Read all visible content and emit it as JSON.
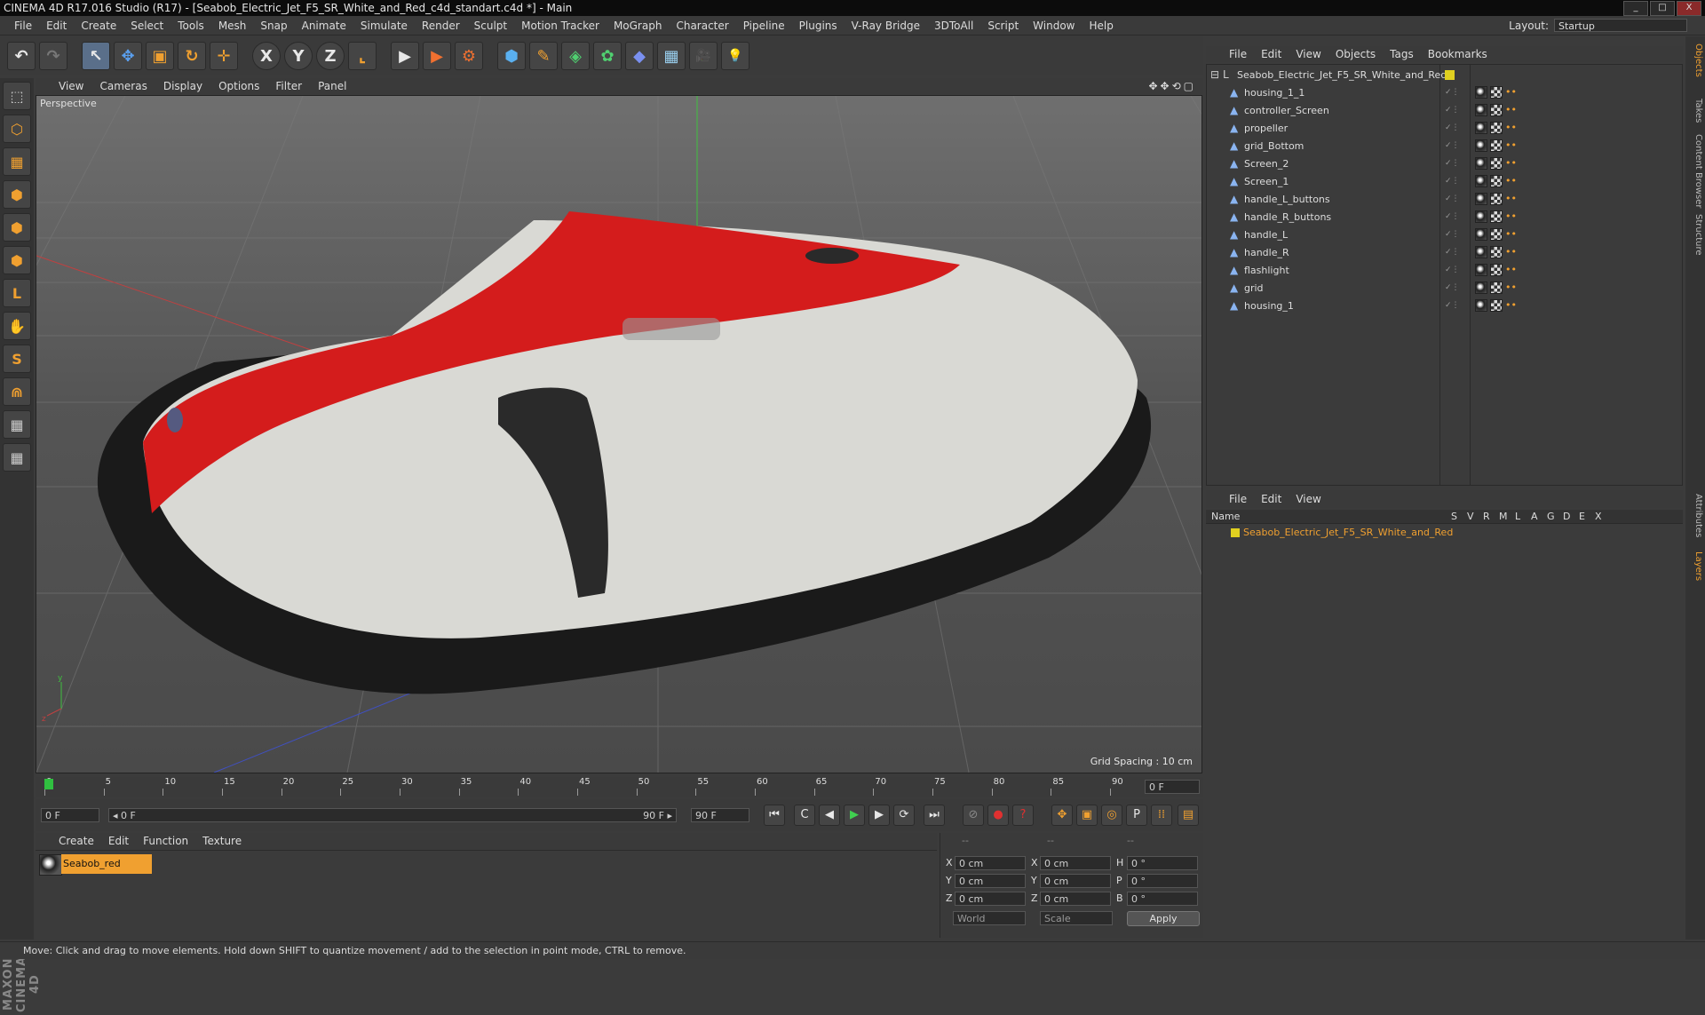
{
  "window": {
    "title": "CINEMA 4D R17.016 Studio (R17) - [Seabob_Electric_Jet_F5_SR_White_and_Red_c4d_standart.c4d *] - Main",
    "buttons": [
      "_",
      "□",
      "X"
    ]
  },
  "menubar": {
    "items": [
      "File",
      "Edit",
      "Create",
      "Select",
      "Tools",
      "Mesh",
      "Snap",
      "Animate",
      "Simulate",
      "Render",
      "Sculpt",
      "Motion Tracker",
      "MoGraph",
      "Character",
      "Pipeline",
      "Plugins",
      "V-Ray Bridge",
      "3DToAll",
      "Script",
      "Window",
      "Help"
    ],
    "layout_label": "Layout:",
    "layout_value": "Startup"
  },
  "toolbar": {
    "glyphs": {
      "undo": "↶",
      "redo": "↷",
      "live_select": "↖",
      "move": "✥",
      "scale": "▣",
      "rotate": "↻",
      "transform": "✛",
      "x_axis": "X",
      "y_axis": "Y",
      "z_axis": "Z",
      "coord": "⌞",
      "render_view": "▶",
      "render_pv": "▶",
      "render_settings": "⚙",
      "cube": "⬢",
      "pen": "✎",
      "subdiv": "◈",
      "cloner": "✿",
      "deformer": "◆",
      "floor": "▦",
      "camera": "🎥",
      "light": "💡"
    }
  },
  "lefttools": [
    "⬚",
    "⬡",
    "▦",
    "⬢",
    "⬢",
    "⬢",
    "L",
    "✋",
    "S",
    "⋒",
    "▦",
    "▦"
  ],
  "maxon_logo": "MAXON CINEMA 4D",
  "viewport": {
    "menu": [
      "View",
      "Cameras",
      "Display",
      "Options",
      "Filter",
      "Panel"
    ],
    "nav_icons": "✥✥⟲▢",
    "label": "Perspective",
    "grid_spacing": "Grid Spacing : 10 cm",
    "axis_y": "y",
    "axis_z": "z"
  },
  "timeline": {
    "ticks": [
      "0",
      "5",
      "10",
      "15",
      "20",
      "25",
      "30",
      "35",
      "40",
      "45",
      "50",
      "55",
      "60",
      "65",
      "70",
      "75",
      "80",
      "85",
      "90"
    ],
    "current_frame": "0 F",
    "current_frame_fraction": 0.0
  },
  "transport": {
    "start_field": "0 F",
    "range_start": "◂ 0 F",
    "range_end": "90 F ▸",
    "end_field": "90 F",
    "buttons": [
      "⏮",
      "C",
      "◀",
      "▶",
      "▶",
      "⟳",
      "⏭",
      "⊘",
      "●",
      "?",
      "✥",
      "▣",
      "◎",
      "P",
      "⁞⁞",
      "▤"
    ]
  },
  "material_manager": {
    "menu": [
      "Create",
      "Edit",
      "Function",
      "Texture"
    ],
    "materials": [
      {
        "name": "Seabob_red"
      }
    ]
  },
  "coords": {
    "headers": [
      "--",
      "--",
      "--"
    ],
    "rows": [
      {
        "l1": "X",
        "v1": "0 cm",
        "l2": "X",
        "v2": "0 cm",
        "l3": "H",
        "v3": "0 °"
      },
      {
        "l1": "Y",
        "v1": "0 cm",
        "l2": "Y",
        "v2": "0 cm",
        "l3": "P",
        "v3": "0 °"
      },
      {
        "l1": "Z",
        "v1": "0 cm",
        "l2": "Z",
        "v2": "0 cm",
        "l3": "B",
        "v3": "0 °"
      }
    ],
    "mode1": "World",
    "mode2": "Scale",
    "apply": "Apply"
  },
  "status": "Move: Click and drag to move elements. Hold down SHIFT to quantize movement / add to the selection in point mode, CTRL to remove.",
  "objects": {
    "menu": [
      "File",
      "Edit",
      "View",
      "Objects",
      "Tags",
      "Bookmarks"
    ],
    "root": "Seabob_Electric_Jet_F5_SR_White_and_Red",
    "children": [
      "housing_1_1",
      "controller_Screen",
      "propeller",
      "grid_Bottom",
      "Screen_2",
      "Screen_1",
      "handle_L_buttons",
      "handle_R_buttons",
      "handle_L",
      "handle_R",
      "flashlight",
      "grid",
      "housing_1"
    ]
  },
  "layers": {
    "menu": [
      "File",
      "Edit",
      "View"
    ],
    "header_name": "Name",
    "header_cols": [
      "S",
      "V",
      "R",
      "M",
      "L",
      "A",
      "G",
      "D",
      "E",
      "X"
    ],
    "rows": [
      "Seabob_Electric_Jet_F5_SR_White_and_Red"
    ]
  },
  "side_tabs": [
    "Objects",
    "Takes",
    "Content Browser",
    "Structure",
    "Attributes",
    "Layers"
  ],
  "colors": {
    "accent": "#f0a030",
    "selected_tool": "#5a6f8a",
    "red_body": "#d41c1c",
    "white_body": "#d9d9d4"
  }
}
